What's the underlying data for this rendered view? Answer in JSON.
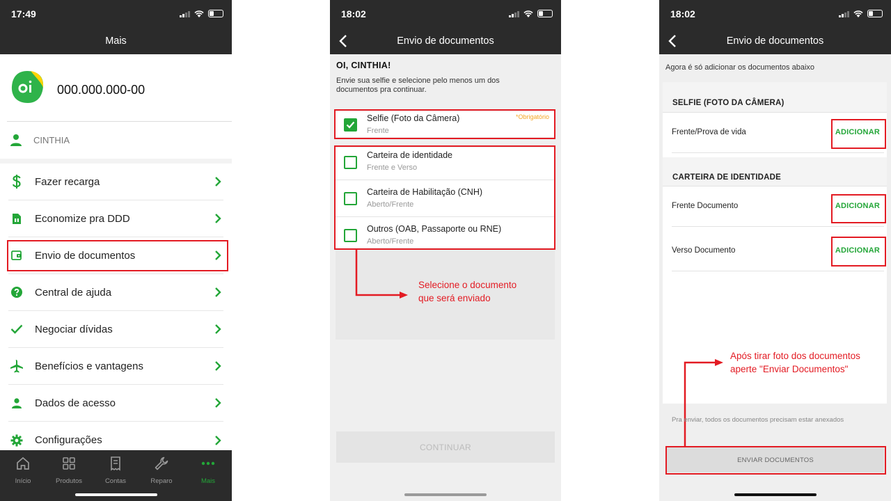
{
  "colors": {
    "accent": "#23a638",
    "highlight": "#e31b23",
    "warning": "#f5a623",
    "header": "#2b2b2b"
  },
  "screen1": {
    "time": "17:49",
    "title": "Mais",
    "cpf": "000.000.000-00",
    "user": "CINTHIA",
    "menu": [
      {
        "label": "Fazer recarga",
        "icon": "dollar-icon"
      },
      {
        "label": "Economize pra DDD",
        "icon": "sim-card-icon"
      },
      {
        "label": "Envio de documentos",
        "icon": "wallet-icon"
      },
      {
        "label": "Central de ajuda",
        "icon": "help-icon"
      },
      {
        "label": "Negociar dívidas",
        "icon": "check-icon"
      },
      {
        "label": "Benefícios e vantagens",
        "icon": "airplane-icon"
      },
      {
        "label": "Dados de acesso",
        "icon": "user-icon"
      },
      {
        "label": "Configurações",
        "icon": "gear-icon"
      }
    ],
    "tabs": [
      {
        "label": "Início",
        "icon": "home-icon"
      },
      {
        "label": "Produtos",
        "icon": "grid-icon"
      },
      {
        "label": "Contas",
        "icon": "bill-icon"
      },
      {
        "label": "Reparo",
        "icon": "wrench-icon"
      },
      {
        "label": "Mais",
        "icon": "more-icon"
      }
    ]
  },
  "screen2": {
    "time": "18:02",
    "title": "Envio de documentos",
    "hello": "OI, CINTHIA!",
    "instructions": "Envie sua selfie e selecione pelo menos um dos documentos pra continuar.",
    "required_label": "*Obrigatório",
    "selfie": {
      "title": "Selfie (Foto da Câmera)",
      "sub": "Frente",
      "checked": true
    },
    "documents": [
      {
        "title": "Carteira de identidade",
        "sub": "Frente e Verso"
      },
      {
        "title": "Carteira de Habilitação (CNH)",
        "sub": "Aberto/Frente"
      },
      {
        "title": "Outros (OAB, Passaporte ou RNE)",
        "sub": "Aberto/Frente"
      }
    ],
    "annotation_line1": "Selecione  o documento",
    "annotation_line2": "que será enviado",
    "continue_label": "CONTINUAR"
  },
  "screen3": {
    "time": "18:02",
    "title": "Envio de documentos",
    "hint": "Agora é só adicionar os documentos abaixo",
    "selfie_section": "SELFIE (FOTO DA CÂMERA)",
    "selfie_row": "Frente/Prova de vida",
    "id_section": "CARTEIRA DE IDENTIDADE",
    "id_rows": [
      "Frente Documento",
      "Verso Documento"
    ],
    "add_label": "ADICIONAR",
    "annotation_line1": "Após tirar foto dos documentos",
    "annotation_line2": "aperte \"Enviar Documentos\"",
    "footer": "Pra enviar, todos os documentos precisam estar anexados",
    "send_label": "ENVIAR DOCUMENTOS"
  }
}
